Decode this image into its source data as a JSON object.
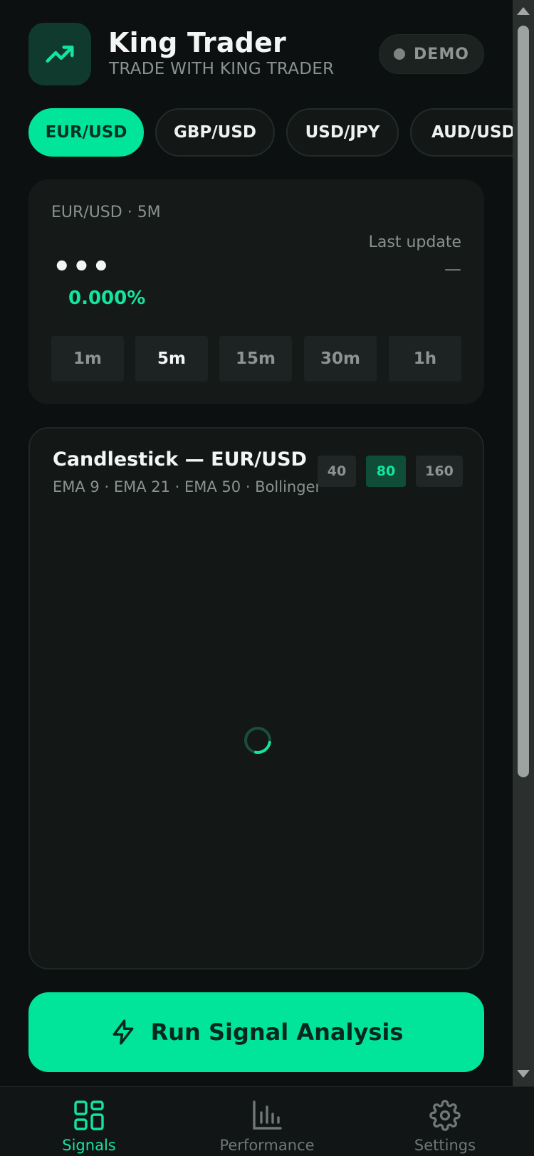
{
  "header": {
    "title": "King Trader",
    "subtitle": "TRADE WITH KING TRADER",
    "mode_badge": "DEMO",
    "logo_icon": "trending-up-icon"
  },
  "pairs": {
    "selected": "EUR/USD",
    "items": [
      {
        "label": "EUR/USD"
      },
      {
        "label": "GBP/USD"
      },
      {
        "label": "USD/JPY"
      },
      {
        "label": "AUD/USD"
      }
    ]
  },
  "quote": {
    "label": "EUR/USD · 5M",
    "price": "•••",
    "change": "0.000%",
    "last_update_label": "Last update",
    "last_update_value": "—",
    "selected_timeframe": "5m",
    "timeframes": [
      "1m",
      "5m",
      "15m",
      "30m",
      "1h"
    ]
  },
  "chart": {
    "title": "Candlestick — EUR/USD",
    "subtitle": "EMA 9 · EMA 21 · EMA 50 · Bollinger",
    "selected_zoom": "80",
    "zoom_options": [
      "40",
      "80",
      "160"
    ],
    "loading": true
  },
  "actions": {
    "run_label": "Run Signal Analysis",
    "run_icon": "lightning-bolt-icon"
  },
  "nav": {
    "active": "Signals",
    "items": [
      {
        "label": "Signals",
        "icon": "grid-icon"
      },
      {
        "label": "Performance",
        "icon": "bar-chart-icon"
      },
      {
        "label": "Settings",
        "icon": "gear-icon"
      }
    ]
  },
  "colors": {
    "accent": "#00e59a",
    "background": "#0c1010",
    "card": "#151a19",
    "muted_text": "#8a928f"
  }
}
